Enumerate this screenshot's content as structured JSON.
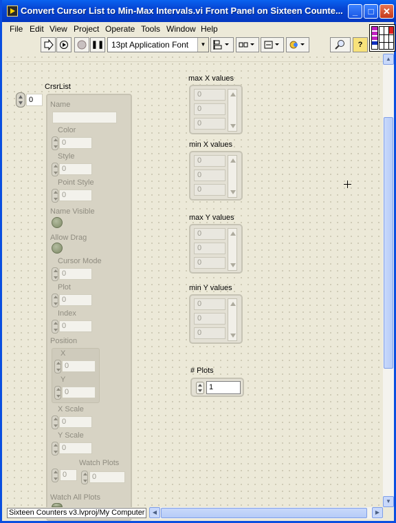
{
  "window": {
    "title": "Convert Cursor List to Min-Max Intervals.vi Front Panel on Sixteen Counte...",
    "minimize": "_",
    "maximize": "□",
    "close": "✕"
  },
  "menu": [
    "File",
    "Edit",
    "View",
    "Project",
    "Operate",
    "Tools",
    "Window",
    "Help"
  ],
  "toolbar": {
    "font_select": "13pt Application Font",
    "help_button": "?",
    "search_icon": "magnifier-icon",
    "run_icon": "run-arrow-icon",
    "run_continuous_icon": "run-continuous-icon",
    "abort_icon": "abort-icon",
    "pause_label": "❚❚"
  },
  "crsrlist": {
    "label": "CrsrList",
    "index": "0",
    "fields": {
      "name": "Name",
      "color": "Color",
      "color_val": "0",
      "style": "Style",
      "style_val": "0",
      "point_style": "Point Style",
      "point_style_val": "0",
      "name_visible": "Name Visible",
      "allow_drag": "Allow Drag",
      "cursor_mode": "Cursor Mode",
      "cursor_mode_val": "0",
      "plot": "Plot",
      "plot_val": "0",
      "index": "Index",
      "index_val": "0",
      "position": "Position",
      "x": "X",
      "x_val": "0",
      "y": "Y",
      "y_val": "0",
      "x_scale": "X Scale",
      "x_scale_val": "0",
      "y_scale": "Y Scale",
      "y_scale_val": "0",
      "watch_plots": "Watch Plots",
      "watch_plots_idx": "0",
      "watch_plots_val": "0",
      "watch_all_plots": "Watch All Plots"
    }
  },
  "arrays": [
    {
      "label": "max X values",
      "values": [
        "0",
        "0",
        "0"
      ]
    },
    {
      "label": "min X values",
      "values": [
        "0",
        "0",
        "0"
      ]
    },
    {
      "label": "max Y values",
      "values": [
        "0",
        "0",
        "0"
      ]
    },
    {
      "label": "min Y values",
      "values": [
        "0",
        "0",
        "0"
      ]
    }
  ],
  "plots": {
    "label": "# Plots",
    "value": "1"
  },
  "status": {
    "path": "Sixteen Counters v3.lvproj/My Computer"
  }
}
